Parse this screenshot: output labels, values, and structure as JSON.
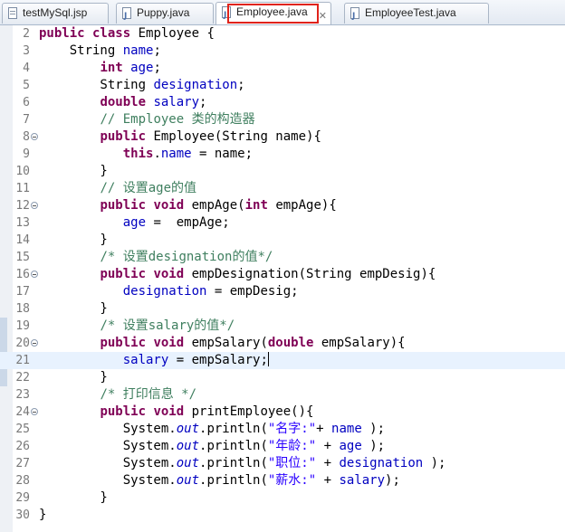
{
  "tabs": [
    {
      "label": "testMySql.jsp",
      "icon": "jsp-file-icon",
      "active": false
    },
    {
      "label": "Puppy.java",
      "icon": "java-file-icon",
      "active": false
    },
    {
      "label": "Employee.java",
      "icon": "java-file-icon",
      "active": true,
      "close": "✕"
    },
    {
      "label": "EmployeeTest.java",
      "icon": "java-file-icon",
      "active": false
    }
  ],
  "editor": {
    "current_line": 21,
    "lines": [
      {
        "n": "2",
        "fold": false,
        "tokens": [
          [
            "kw",
            "public class"
          ],
          [
            "p",
            " Employee {"
          ]
        ]
      },
      {
        "n": "3",
        "fold": false,
        "tokens": [
          [
            "p",
            "    String "
          ],
          [
            "fld",
            "name"
          ],
          [
            "p",
            ";"
          ]
        ]
      },
      {
        "n": "4",
        "fold": false,
        "tokens": [
          [
            "p",
            "        "
          ],
          [
            "kw",
            "int"
          ],
          [
            "p",
            " "
          ],
          [
            "fld",
            "age"
          ],
          [
            "p",
            ";"
          ]
        ]
      },
      {
        "n": "5",
        "fold": false,
        "tokens": [
          [
            "p",
            "        String "
          ],
          [
            "fld",
            "designation"
          ],
          [
            "p",
            ";"
          ]
        ]
      },
      {
        "n": "6",
        "fold": false,
        "tokens": [
          [
            "p",
            "        "
          ],
          [
            "kw",
            "double"
          ],
          [
            "p",
            " "
          ],
          [
            "fld",
            "salary"
          ],
          [
            "p",
            ";"
          ]
        ]
      },
      {
        "n": "7",
        "fold": false,
        "tokens": [
          [
            "p",
            "        "
          ],
          [
            "cm",
            "// Employee 类的构造器"
          ]
        ]
      },
      {
        "n": "8",
        "fold": true,
        "tokens": [
          [
            "p",
            "        "
          ],
          [
            "kw",
            "public"
          ],
          [
            "p",
            " Employee(String name){"
          ]
        ]
      },
      {
        "n": "9",
        "fold": false,
        "tokens": [
          [
            "p",
            "           "
          ],
          [
            "kw",
            "this"
          ],
          [
            "p",
            "."
          ],
          [
            "fld",
            "name"
          ],
          [
            "p",
            " = name;"
          ]
        ]
      },
      {
        "n": "10",
        "fold": false,
        "tokens": [
          [
            "p",
            "        }"
          ]
        ]
      },
      {
        "n": "11",
        "fold": false,
        "tokens": [
          [
            "p",
            "        "
          ],
          [
            "cm",
            "// 设置age的值"
          ]
        ]
      },
      {
        "n": "12",
        "fold": true,
        "tokens": [
          [
            "p",
            "        "
          ],
          [
            "kw",
            "public void"
          ],
          [
            "p",
            " empAge("
          ],
          [
            "kw",
            "int"
          ],
          [
            "p",
            " empAge){"
          ]
        ]
      },
      {
        "n": "13",
        "fold": false,
        "tokens": [
          [
            "p",
            "           "
          ],
          [
            "fld",
            "age"
          ],
          [
            "p",
            " =  empAge;"
          ]
        ]
      },
      {
        "n": "14",
        "fold": false,
        "tokens": [
          [
            "p",
            "        }"
          ]
        ]
      },
      {
        "n": "15",
        "fold": false,
        "tokens": [
          [
            "p",
            "        "
          ],
          [
            "cm",
            "/* 设置designation的值*/"
          ]
        ]
      },
      {
        "n": "16",
        "fold": true,
        "tokens": [
          [
            "p",
            "        "
          ],
          [
            "kw",
            "public void"
          ],
          [
            "p",
            " empDesignation(String empDesig){"
          ]
        ]
      },
      {
        "n": "17",
        "fold": false,
        "tokens": [
          [
            "p",
            "           "
          ],
          [
            "fld",
            "designation"
          ],
          [
            "p",
            " = empDesig;"
          ]
        ]
      },
      {
        "n": "18",
        "fold": false,
        "tokens": [
          [
            "p",
            "        }"
          ]
        ]
      },
      {
        "n": "19",
        "fold": false,
        "tokens": [
          [
            "p",
            "        "
          ],
          [
            "cm",
            "/* 设置salary的值*/"
          ]
        ]
      },
      {
        "n": "20",
        "fold": true,
        "tokens": [
          [
            "p",
            "        "
          ],
          [
            "kw",
            "public void"
          ],
          [
            "p",
            " empSalary("
          ],
          [
            "kw",
            "double"
          ],
          [
            "p",
            " empSalary){"
          ]
        ]
      },
      {
        "n": "21",
        "fold": false,
        "tokens": [
          [
            "p",
            "           "
          ],
          [
            "fld",
            "salary"
          ],
          [
            "p",
            " = empSalary;"
          ]
        ]
      },
      {
        "n": "22",
        "fold": false,
        "tokens": [
          [
            "p",
            "        }"
          ]
        ]
      },
      {
        "n": "23",
        "fold": false,
        "tokens": [
          [
            "p",
            "        "
          ],
          [
            "cm",
            "/* 打印信息 */"
          ]
        ]
      },
      {
        "n": "24",
        "fold": true,
        "tokens": [
          [
            "p",
            "        "
          ],
          [
            "kw",
            "public void"
          ],
          [
            "p",
            " printEmployee(){"
          ]
        ]
      },
      {
        "n": "25",
        "fold": false,
        "tokens": [
          [
            "p",
            "           System."
          ],
          [
            "st",
            "out"
          ],
          [
            "p",
            ".println("
          ],
          [
            "str",
            "\"名字:\""
          ],
          [
            "p",
            "+ "
          ],
          [
            "fld",
            "name"
          ],
          [
            "p",
            " );"
          ]
        ]
      },
      {
        "n": "26",
        "fold": false,
        "tokens": [
          [
            "p",
            "           System."
          ],
          [
            "st",
            "out"
          ],
          [
            "p",
            ".println("
          ],
          [
            "str",
            "\"年龄:\""
          ],
          [
            "p",
            " + "
          ],
          [
            "fld",
            "age"
          ],
          [
            "p",
            " );"
          ]
        ]
      },
      {
        "n": "27",
        "fold": false,
        "tokens": [
          [
            "p",
            "           System."
          ],
          [
            "st",
            "out"
          ],
          [
            "p",
            ".println("
          ],
          [
            "str",
            "\"职位:\""
          ],
          [
            "p",
            " + "
          ],
          [
            "fld",
            "designation"
          ],
          [
            "p",
            " );"
          ]
        ]
      },
      {
        "n": "28",
        "fold": false,
        "tokens": [
          [
            "p",
            "           System."
          ],
          [
            "st",
            "out"
          ],
          [
            "p",
            ".println("
          ],
          [
            "str",
            "\"薪水:\""
          ],
          [
            "p",
            " + "
          ],
          [
            "fld",
            "salary"
          ],
          [
            "p",
            ");"
          ]
        ]
      },
      {
        "n": "29",
        "fold": false,
        "tokens": [
          [
            "p",
            "        }"
          ]
        ]
      },
      {
        "n": "30",
        "fold": false,
        "tokens": [
          [
            "p",
            "}"
          ]
        ]
      }
    ]
  },
  "colors": {
    "keyword": "#7f0055",
    "field": "#0000c0",
    "comment": "#3f7f5f",
    "string": "#2a00ff",
    "current_line": "#e8f2fe",
    "tab_highlight": "#e0231b"
  }
}
